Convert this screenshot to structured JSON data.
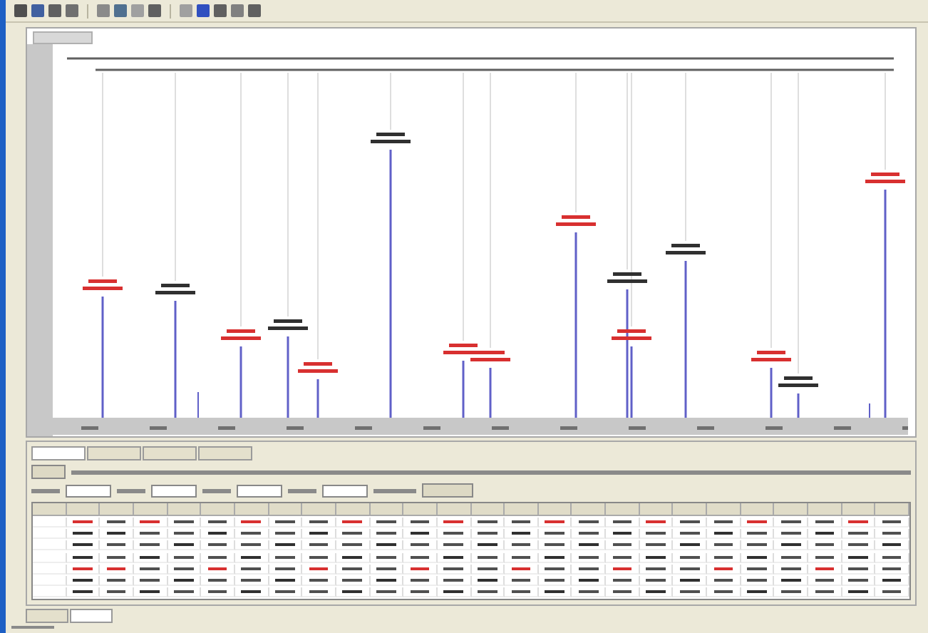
{
  "spectrum": {
    "peaks": [
      {
        "color": "#d83030"
      },
      {
        "color": "#303030"
      },
      {
        "color": "#d83030"
      },
      {
        "color": "#303030"
      },
      {
        "color": "#d83030"
      },
      {
        "color": "#303030"
      },
      {
        "color": "#d83030"
      },
      {
        "color": "#d83030"
      },
      {
        "color": "#d83030"
      },
      {
        "color": "#303030"
      },
      {
        "color": "#d83030"
      },
      {
        "color": "#303030"
      },
      {
        "color": "#d83030"
      },
      {
        "color": "#303030"
      },
      {
        "color": "#d83030"
      }
    ]
  },
  "panel_tabs": [
    {
      "selected": true
    },
    {
      "selected": false
    },
    {
      "selected": false
    },
    {
      "selected": false
    }
  ],
  "table": {
    "rows": [
      {
        "color": "#d83030"
      },
      {
        "color": "#303030"
      },
      {
        "color": "#303030"
      },
      {
        "color": "#303030"
      },
      {
        "color": "#d83030"
      },
      {
        "color": "#303030"
      },
      {
        "color": "#303030"
      }
    ]
  },
  "bottom_tabs": [
    {
      "selected": false
    },
    {
      "selected": true
    }
  ]
}
